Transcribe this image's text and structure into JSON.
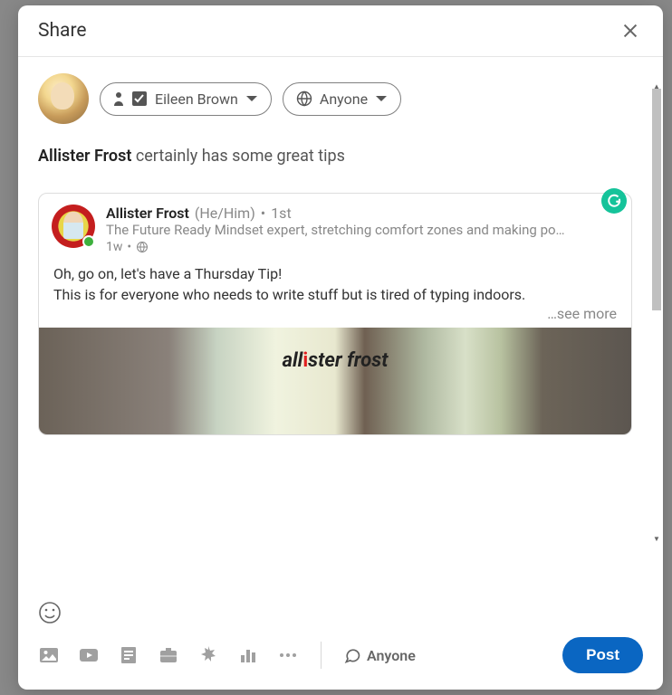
{
  "modal": {
    "title": "Share",
    "close_label": "Close"
  },
  "composer": {
    "user_name": "Eileen Brown",
    "visibility": "Anyone",
    "post_text_prefix": "Allister Frost",
    "post_text_rest": " certainly has some great tips"
  },
  "embedded": {
    "author_name": "Allister Frost",
    "pronouns": "(He/Him)",
    "distance_sep": "•",
    "distance": "1st",
    "headline": "The Future Ready Mindset expert, stretching comfort zones and making po…",
    "age": "1w",
    "age_sep": "•",
    "body_line1": "Oh, go on, let's have a Thursday Tip!",
    "body_line2": "This is for everyone who needs to write stuff but is tired of typing indoors.",
    "see_more": "…see more",
    "media_title_a": "all",
    "media_title_b": "ster frost"
  },
  "footer": {
    "comment_visibility": "Anyone",
    "post_button": "Post"
  }
}
